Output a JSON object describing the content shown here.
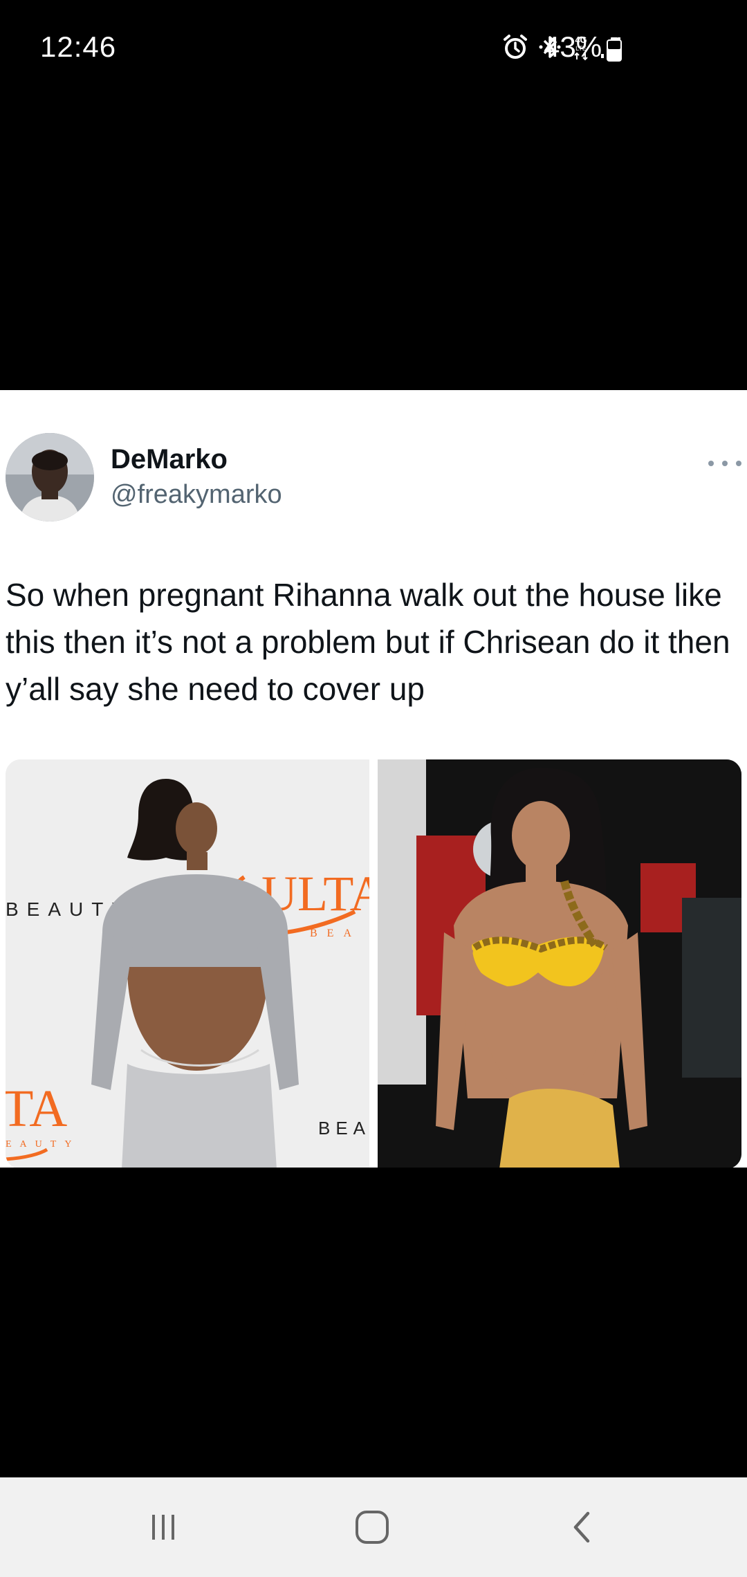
{
  "status_bar": {
    "time": "12:46",
    "battery_percent": "43%",
    "network_label": "4G LTE",
    "icons": [
      "alarm-icon",
      "bluetooth-icon",
      "network-4g-icon",
      "signal-icon",
      "battery-icon"
    ]
  },
  "tweet": {
    "display_name": "DeMarko",
    "handle": "@freakymarko",
    "text": "So when pregnant Rihanna walk out the house like this then it’s not a problem but if Chrisean do it then y’all say she need to cover up",
    "media": [
      {
        "backdrop_text_1": "BEAUTY",
        "backdrop_text_2": "ULTA",
        "backdrop_text_3": "BEA",
        "backdrop_text_4": "TA",
        "backdrop_text_5": "EAUTY",
        "backdrop_text_6": "BEA"
      },
      {}
    ]
  },
  "colors": {
    "name": "#0f1419",
    "handle": "#536471",
    "ulta_orange": "#f26b21"
  },
  "nav_bar": {
    "icons": [
      "recent-apps-icon",
      "home-icon",
      "back-icon"
    ]
  }
}
